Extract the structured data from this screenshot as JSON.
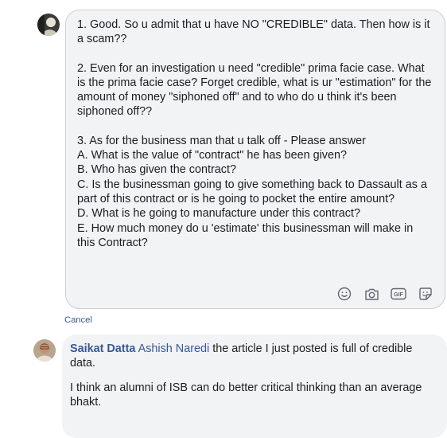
{
  "reply_editor": {
    "paragraphs": [
      [
        "1. Good. So u admit that u have NO \"CREDIBLE\" data. Then how is it a scam??"
      ],
      [
        "2. Even for an investigation u need \"credible\" prima facie case. What is the prima facie case? Forget credible, what is ur \"estimation\" for the amount of money \"siphoned off\" and to who do u think it's been siphoned off??"
      ],
      [
        "3. As for the business man that u talk off - Please answer",
        "A. What is the value of \"contract\" he has been given?",
        "B. Who has given the contract?",
        "C. Is the businessman going to give something back to Dassault as a part of this contract or is he going to pocket the entire amount?",
        "D. What is he going to manufacture under this contract?",
        "E. How much money do u 'estimate' this businessman will make in this Contract?"
      ]
    ],
    "tool_icons": [
      "emoji-icon",
      "camera-icon",
      "gif-icon",
      "sticker-icon"
    ],
    "gif_label": "GIF"
  },
  "cancel_label": "Cancel",
  "comment": {
    "author": "Saikat Datta",
    "mention": "Ashish Naredi",
    "text_after_mention": " the article I just posted is full of credible data.",
    "second_paragraph": "I think an alumni of ISB can do better critical thinking than an average bhakt."
  },
  "colors": {
    "link": "#385898",
    "bubble": "#f2f3f5",
    "border": "#ccd0d5",
    "icon": "#606770"
  }
}
